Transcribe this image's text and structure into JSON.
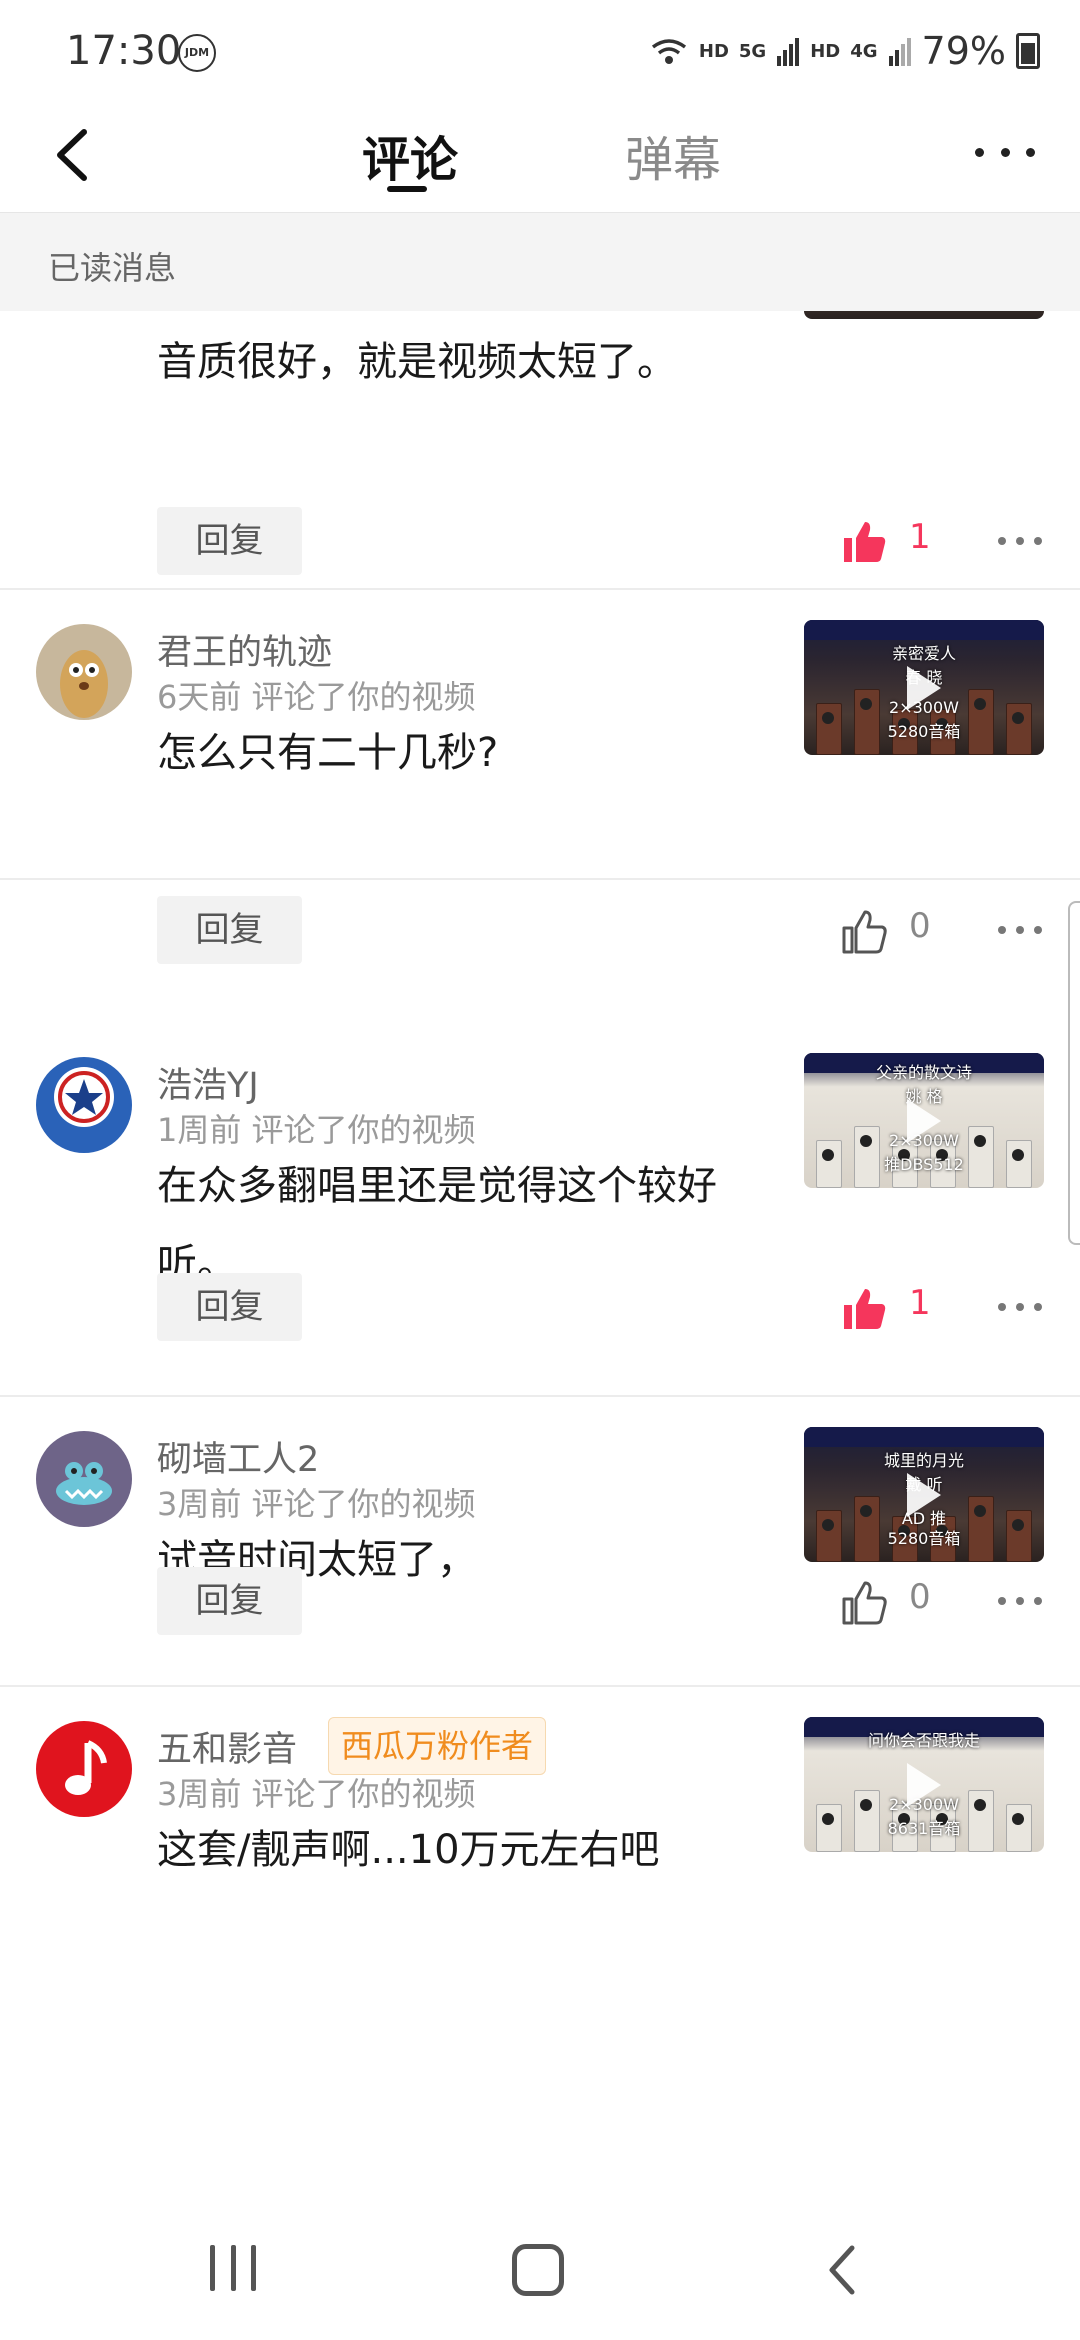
{
  "status_bar": {
    "time": "17:30",
    "badge": "JDM",
    "network_1": "HD",
    "network_2": "5G",
    "network_3": "HD",
    "network_4": "4G",
    "battery": "79%"
  },
  "header": {
    "tabs": [
      {
        "label": "评论",
        "active": true
      },
      {
        "label": "弹幕",
        "active": false
      }
    ]
  },
  "section": {
    "label": "已读消息"
  },
  "comments": [
    {
      "author": "",
      "time": "",
      "text": "音质很好，就是视频太短了。",
      "reply_label": "回复",
      "liked": true,
      "likes": "1",
      "thumb_lines": []
    },
    {
      "author": "君王的轨迹",
      "time": "6天前 评论了你的视频",
      "text": "怎么只有二十几秒?",
      "reply_label": "回复",
      "liked": false,
      "likes": "0",
      "thumb_lines": [
        "亲密爱人",
        "春 晓",
        "2×300W",
        "5280音箱"
      ]
    },
    {
      "author": "浩浩YJ",
      "time": "1周前 评论了你的视频",
      "text": "在众多翻唱里还是觉得这个较好听。",
      "reply_label": "回复",
      "liked": true,
      "likes": "1",
      "thumb_lines": [
        "父亲的散文诗",
        "姚 格",
        "2×300W",
        "推DBS512"
      ]
    },
    {
      "author": "砌墙工人2",
      "time": "3周前 评论了你的视频",
      "text": "试音时间太短了，",
      "reply_label": "回复",
      "liked": false,
      "likes": "0",
      "thumb_lines": [
        "城里的月光",
        "戴 听",
        "AD 推",
        "5280音箱"
      ]
    },
    {
      "author": "五和影音",
      "badge": "西瓜万粉作者",
      "time": "3周前 评论了你的视频",
      "text": "这套/靓声啊...10万元左右吧",
      "thumb_lines": [
        "问你会否跟我走",
        "",
        "2×300W",
        "8631音箱"
      ]
    }
  ],
  "colors": {
    "accent": "#f5365c",
    "fan_badge": "#f08c1e"
  },
  "icons": [
    "back-arrow-icon",
    "more-icon",
    "thumbs-up-icon",
    "play-icon",
    "nav-recent-icon",
    "nav-home-icon",
    "nav-back-icon"
  ]
}
